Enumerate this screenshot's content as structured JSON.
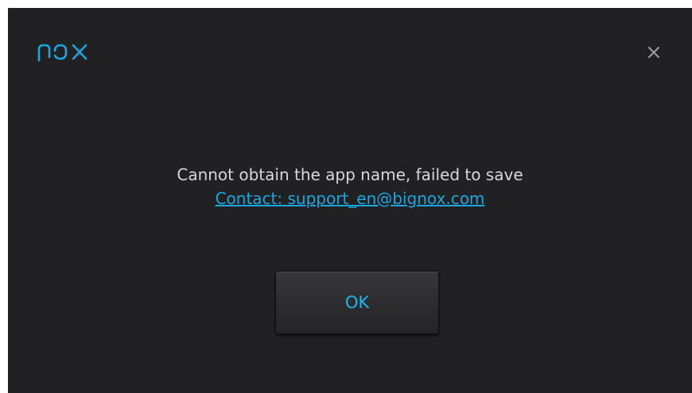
{
  "dialog": {
    "logo_text": "nox",
    "close_glyph": "close-icon",
    "message": "Cannot obtain the app name, failed to save",
    "contact_link": "Contact: support_en@bignox.com",
    "ok_label": "OK"
  },
  "colors": {
    "background": "#212123",
    "accent": "#1aa7e0",
    "text": "#d8d8d8",
    "close_icon": "#9a9a9a"
  }
}
